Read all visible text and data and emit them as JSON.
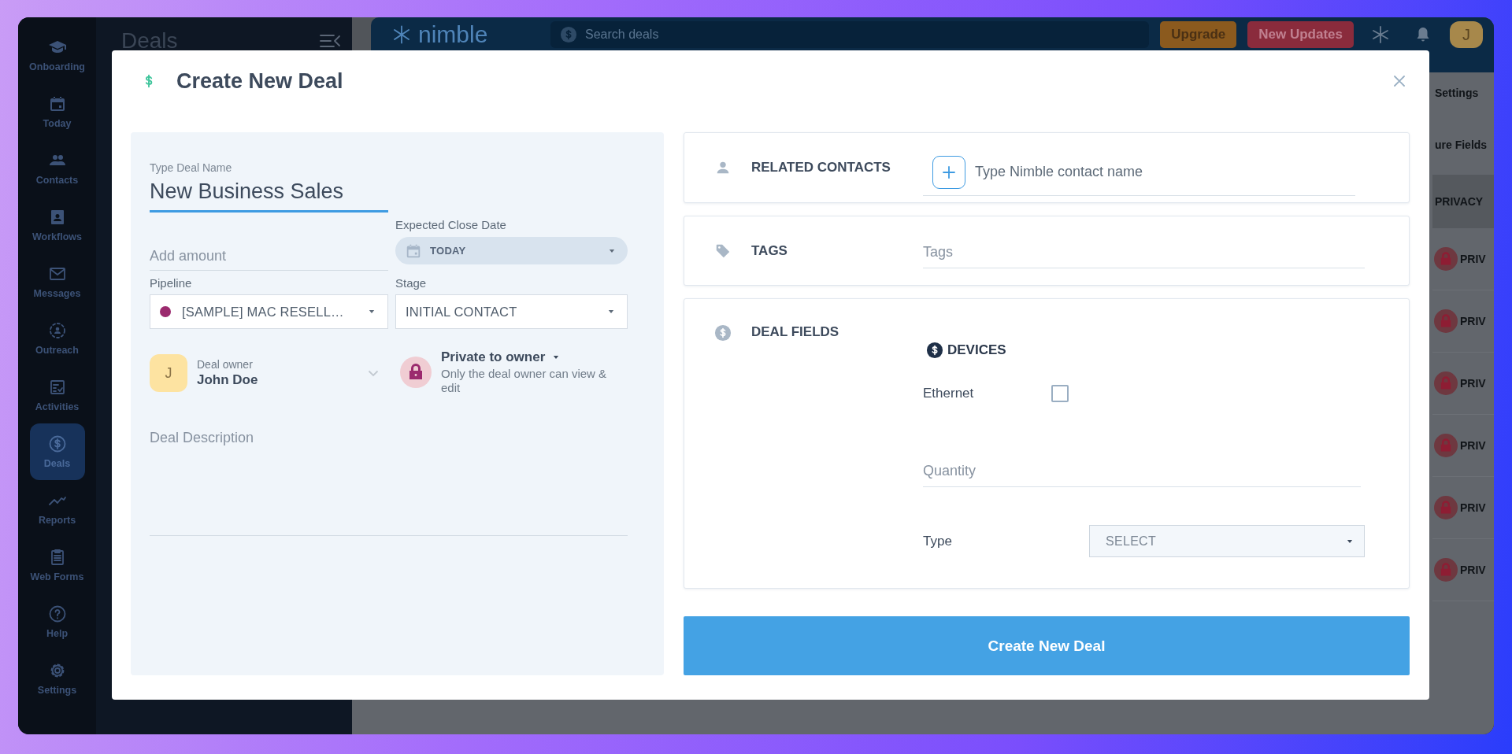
{
  "sidebar": {
    "items": [
      {
        "label": "Onboarding",
        "selected": false
      },
      {
        "label": "Today",
        "selected": false
      },
      {
        "label": "Contacts",
        "selected": false
      },
      {
        "label": "Workflows",
        "selected": false
      },
      {
        "label": "Messages",
        "selected": false
      },
      {
        "label": "Outreach",
        "selected": false
      },
      {
        "label": "Activities",
        "selected": false
      },
      {
        "label": "Deals",
        "selected": true
      },
      {
        "label": "Reports",
        "selected": false
      },
      {
        "label": "Web Forms",
        "selected": false
      },
      {
        "label": "Help",
        "selected": false
      },
      {
        "label": "Settings",
        "selected": false
      }
    ]
  },
  "panel": {
    "title": "Deals"
  },
  "topbar": {
    "logo": "nimble",
    "search": {
      "placeholder": "Search deals"
    },
    "buttons": [
      {
        "label": "Upgrade",
        "kind": "upgrade"
      },
      {
        "label": "New Updates",
        "kind": "updates"
      }
    ],
    "avatar": "J"
  },
  "background": {
    "links": [
      "Settings",
      "ure Fields"
    ],
    "column": "PRIVACY",
    "rows": [
      "PRIV",
      "PRIV",
      "PRIV",
      "PRIV",
      "PRIV",
      "PRIV"
    ]
  },
  "modal": {
    "title": "Create New Deal",
    "deal_name": {
      "label": "Type Deal Name",
      "value": "New Business Sales"
    },
    "amount": {
      "placeholder": "Add amount"
    },
    "close_date": {
      "label": "Expected Close Date",
      "value": "TODAY"
    },
    "pipeline": {
      "label": "Pipeline",
      "value": "[SAMPLE] MAC RESELL…"
    },
    "stage": {
      "label": "Stage",
      "value": "INITIAL CONTACT"
    },
    "owner": {
      "label": "Deal owner",
      "name": "John Doe",
      "initial": "J"
    },
    "privacy": {
      "title": "Private to owner",
      "description": "Only the deal owner can view & edit"
    },
    "description": {
      "placeholder": "Deal Description"
    },
    "sections": [
      {
        "kind": "contacts",
        "title": "RELATED CONTACTS",
        "placeholder": "Type Nimble contact name"
      },
      {
        "kind": "tags",
        "title": "TAGS",
        "placeholder": "Tags"
      },
      {
        "kind": "fields",
        "title": "DEAL FIELDS",
        "group": "DEVICES",
        "fields": [
          {
            "kind": "checkbox",
            "label": "Ethernet",
            "checked": false
          },
          {
            "kind": "text",
            "placeholder": "Quantity"
          },
          {
            "kind": "select",
            "label": "Type",
            "value": "SELECT"
          }
        ]
      }
    ],
    "submit": "Create New Deal"
  }
}
